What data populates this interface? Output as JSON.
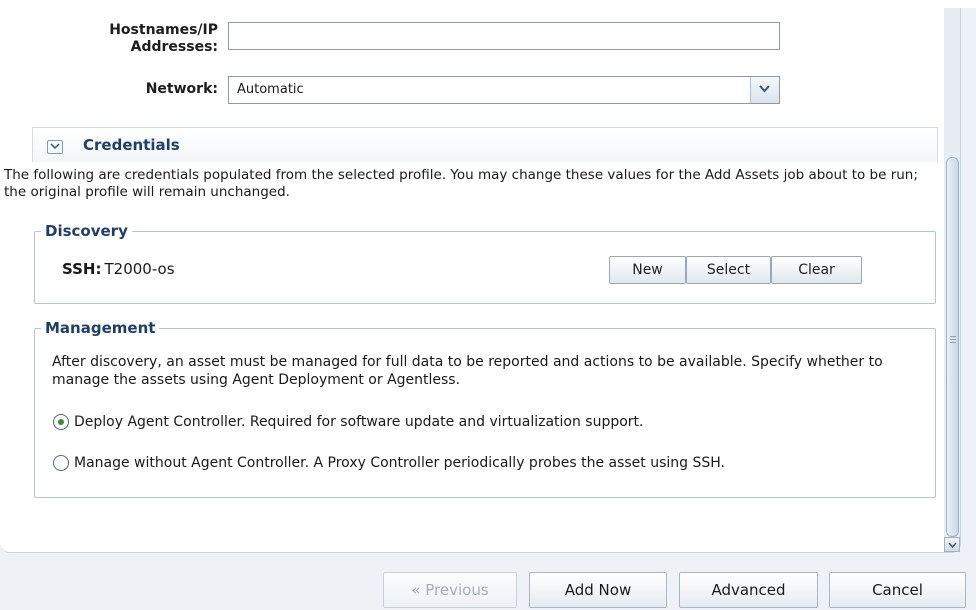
{
  "form": {
    "hostnames_label_line1": "Hostnames/IP",
    "hostnames_label_line2": "Addresses:",
    "hostnames_value": "",
    "network_label": "Network:",
    "network_value": "Automatic"
  },
  "credentials": {
    "title": "Credentials",
    "description": "The following are credentials populated from the selected profile. You may change these values for the Add Assets job about to be run; the original profile will remain unchanged."
  },
  "discovery": {
    "legend": "Discovery",
    "ssh_label": "SSH:",
    "ssh_value": "T2000-os",
    "buttons": {
      "new": "New",
      "select": "Select",
      "clear": "Clear"
    }
  },
  "management": {
    "legend": "Management",
    "text": "After discovery, an asset must be managed for full data to be reported and actions to be available. Specify whether to manage the assets using Agent Deployment or Agentless.",
    "options": [
      {
        "label": "Deploy Agent Controller. Required for software update and virtualization support.",
        "selected": true
      },
      {
        "label": "Manage without Agent Controller. A Proxy Controller periodically probes the asset using SSH.",
        "selected": false
      }
    ]
  },
  "footer": {
    "previous": "« Previous",
    "add_now": "Add Now",
    "advanced": "Advanced",
    "cancel": "Cancel"
  },
  "colors": {
    "section_title": "#1f3f6a",
    "radio_selected": "#3f8a3a"
  },
  "icons": {
    "network_dropdown": "chevron-down-icon",
    "credentials_toggle": "chevron-down-icon",
    "scroll_down": "chevron-down-icon"
  }
}
